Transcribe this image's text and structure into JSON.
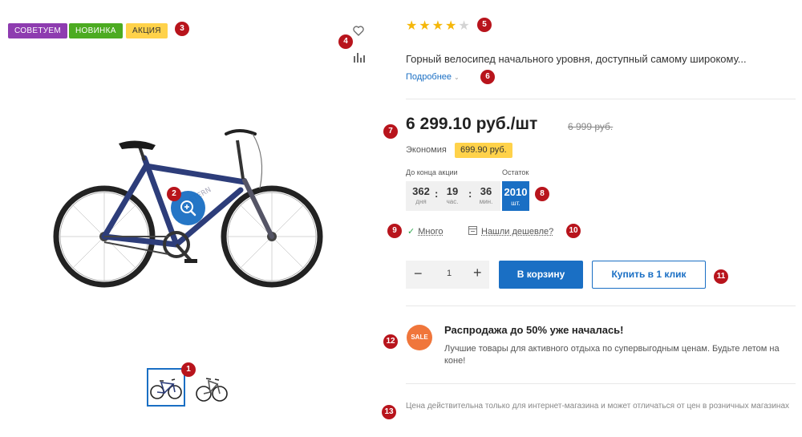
{
  "badges": [
    {
      "label": "Советуем",
      "bg": "#8e3cb0",
      "fg": "#ffffff"
    },
    {
      "label": "Новинка",
      "bg": "#4cab21",
      "fg": "#ffffff"
    },
    {
      "label": "Акция",
      "bg": "#ffd24a",
      "fg": "#333333"
    }
  ],
  "product_icons": {
    "favorite": "heart-icon",
    "compare": "bar-chart-icon",
    "zoom": "zoom-in-icon"
  },
  "rating": {
    "value": 4,
    "max": 5
  },
  "description": "Горный велосипед начального уровня, доступный самому широкому...",
  "more_link": "Подробнее",
  "price": {
    "current": "6 299.10 руб./шт",
    "old": "6 999 руб."
  },
  "economy": {
    "label": "Экономия",
    "value": "699.90 руб."
  },
  "timer": {
    "label": "До конца акции",
    "days": "362",
    "days_unit": "дня",
    "hours": "19",
    "hours_unit": "час.",
    "minutes": "36",
    "minutes_unit": "мин."
  },
  "stock": {
    "label": "Остаток",
    "value": "2010",
    "unit": "шт."
  },
  "availability": "Много",
  "found_cheaper": "Нашли дешевле?",
  "quantity": "1",
  "buttons": {
    "cart": "В корзину",
    "one_click": "Купить в 1 клик"
  },
  "promo": {
    "icon_text": "SALE",
    "title": "Распродажа до 50% уже началась!",
    "text": "Лучшие товары для активного отдыха по супервыгодным ценам. Будьте летом на коне!"
  },
  "disclaimer": "Цена действительна только для интернет-магазина и может отличаться от цен в розничных магазинах",
  "markers": [
    "1",
    "2",
    "3",
    "4",
    "5",
    "6",
    "7",
    "8",
    "9",
    "10",
    "11",
    "12",
    "13"
  ],
  "colors": {
    "accent": "#1a6fc4",
    "marker": "#b8141c",
    "star": "#f5b70a",
    "highlight": "#ffd24a",
    "sale": "#f0763b"
  }
}
